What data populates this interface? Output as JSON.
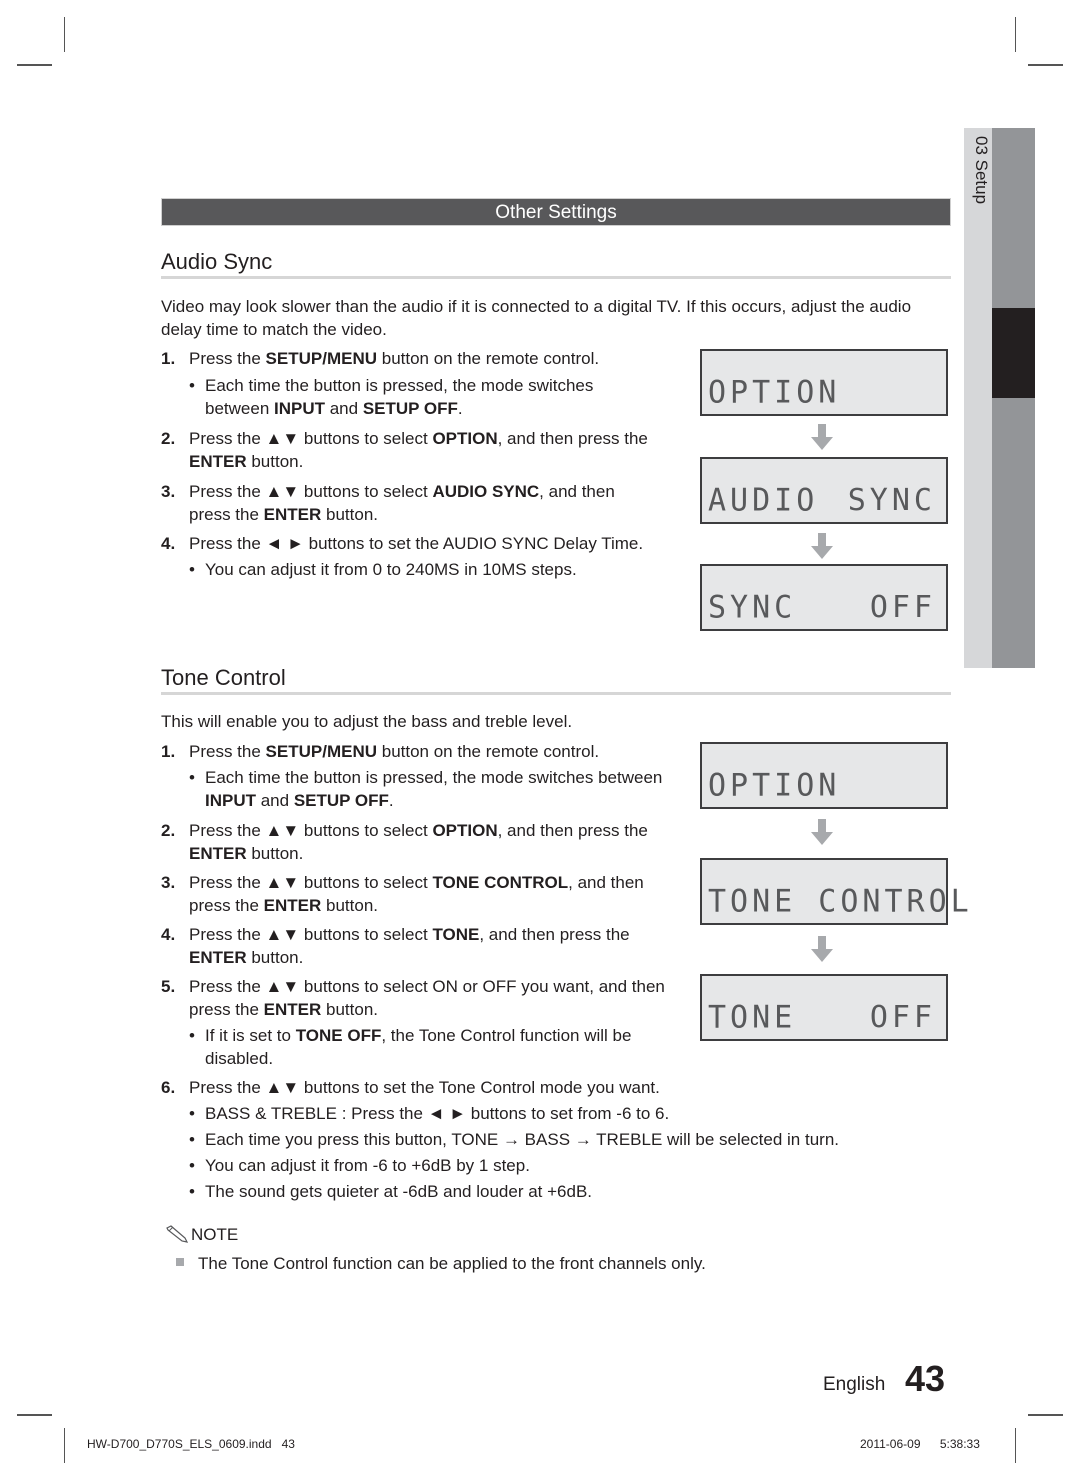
{
  "section_bar": "Other Settings",
  "side_tab": {
    "number": "03",
    "label": "Setup",
    "text": "03  Setup"
  },
  "audio_sync": {
    "title": "Audio Sync",
    "intro": "Video may look slower than the audio if it is connected to a digital TV. If this occurs, adjust the audio delay time to match the video.",
    "intro_line1": "Video may look slower than the audio if it is connected to a digital TV. If this occurs, adjust the audio",
    "intro_line2": "delay time to match the video.",
    "steps": [
      {
        "num": "1.",
        "pre": "Press the ",
        "bold": "SETUP/MENU",
        "post": " button on the remote control."
      },
      {
        "num": "2.",
        "line1_pre": "Press the ▲▼ buttons to select ",
        "line1_bold": "OPTION",
        "line1_post": ", and then press the",
        "line2_bold": "ENTER",
        "line2_post": " button."
      },
      {
        "num": "3.",
        "line1_pre": "Press the ▲▼ buttons to select ",
        "line1_bold": "AUDIO SYNC",
        "line1_post": ", and then",
        "line2_pre": "press the ",
        "line2_bold": "ENTER",
        "line2_post": " button."
      },
      {
        "num": "4.",
        "text": "Press the ◄ ► buttons to set the AUDIO SYNC Delay Time."
      }
    ],
    "bullets": {
      "step1": {
        "line1": "Each time the button is pressed, the mode switches",
        "line2_pre": "between ",
        "b1": "INPUT",
        "mid": " and ",
        "b2": "SETUP OFF",
        "end": "."
      },
      "step4": "You can adjust it from 0 to 240MS in 10MS steps."
    },
    "displays": [
      {
        "left": "OPTION",
        "right": ""
      },
      {
        "left": "AUDIO",
        "right": "SYNC"
      },
      {
        "left": "SYNC",
        "right": "OFF"
      }
    ]
  },
  "tone_control": {
    "title": "Tone Control",
    "intro": "This will enable you to adjust the bass and treble level.",
    "steps": [
      {
        "num": "1.",
        "pre": "Press the ",
        "bold": "SETUP/MENU",
        "post": " button on the remote control."
      },
      {
        "num": "2.",
        "line1_pre": "Press the ▲▼ buttons to select ",
        "line1_bold": "OPTION",
        "line1_post": ", and then press the",
        "line2_bold": "ENTER",
        "line2_post": " button."
      },
      {
        "num": "3.",
        "line1_pre": "Press the ▲▼ buttons to select ",
        "line1_bold": "TONE CONTROL",
        "line1_post": ", and then",
        "line2_pre": "press the ",
        "line2_bold": "ENTER",
        "line2_post": " button."
      },
      {
        "num": "4.",
        "line1_pre": "Press the ▲▼ buttons to select ",
        "line1_bold": "TONE",
        "line1_post": ", and then press the",
        "line2_bold": "ENTER",
        "line2_post": " button."
      },
      {
        "num": "5.",
        "line1": "Press the ▲▼ buttons to select ON or OFF you want, and then",
        "line2_pre": "press the ",
        "line2_bold": "ENTER",
        "line2_post": " button."
      },
      {
        "num": "6.",
        "text": "Press the ▲▼ buttons to set the Tone Control mode you want."
      }
    ],
    "bullets": {
      "step1": {
        "line1": "Each time the button is pressed, the mode switches between",
        "b1": "INPUT",
        "mid": " and ",
        "b2": "SETUP OFF",
        "end": "."
      },
      "step5": {
        "pre": "If it is set to ",
        "bold": "TONE OFF",
        "post": ", the Tone Control function will be",
        "line2": "disabled."
      },
      "step6": [
        "BASS & TREBLE : Press the ◄ ► buttons to set from -6 to 6.",
        "Each time you press this button, TONE → BASS → TREBLE will be selected in turn.",
        "You can adjust it from -6 to +6dB by 1 step.",
        "The sound gets quieter at -6dB and louder at +6dB."
      ]
    },
    "displays": [
      {
        "left": "OPTION",
        "right": ""
      },
      {
        "left": "TONE CONTROL",
        "right": ""
      },
      {
        "left": "TONE",
        "right": "OFF"
      }
    ]
  },
  "note": {
    "heading": "NOTE",
    "items": [
      "The Tone Control function can be applied to the front channels only."
    ]
  },
  "footer": {
    "language": "English",
    "page_number": "43",
    "slug_file": "HW-D700_D770S_ELS_0609.indd   43",
    "slug_date": "2011-06-09",
    "slug_time": "5:38:33"
  }
}
